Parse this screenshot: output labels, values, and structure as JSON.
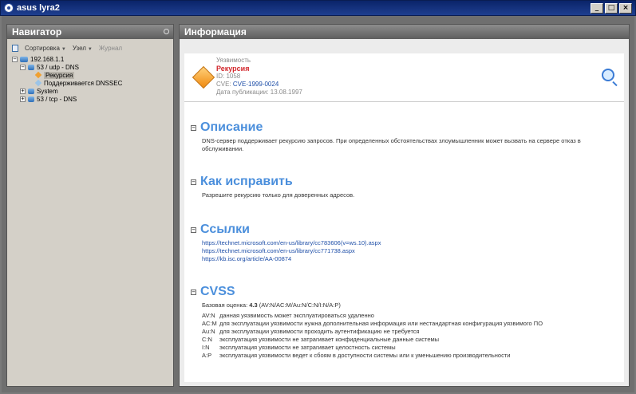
{
  "window": {
    "title": "asus lyra2",
    "buttons": [
      "_",
      "□",
      "×"
    ]
  },
  "navigator": {
    "title": "Навигатор",
    "toolbar": {
      "sort_label": "Сортировка",
      "node_label": "Узел",
      "journal_label": "Журнал"
    },
    "tree": {
      "root": "192.168.1.1",
      "n1": "53 / udp - DNS",
      "n1a": "Рекурсия",
      "n1b": "Поддерживается DNSSEC",
      "n2": "System",
      "n3": "53 / tcp - DNS"
    }
  },
  "info": {
    "title": "Информация",
    "vulnerability": {
      "type_label": "Уязвимость",
      "name": "Рекурсия",
      "id": "ID: 1058",
      "cve_label": "CVE:",
      "cve": "CVE-1999-0024",
      "published": "Дата публикации: 13.08.1997"
    },
    "description": {
      "title": "Описание",
      "text": "DNS-сервер поддерживает рекурсию запросов. При определенных обстоятельствах злоумышленник может вызвать на сервере отказ в обслуживании."
    },
    "fix": {
      "title": "Как исправить",
      "text": "Разрешите рекурсию только для доверенных адресов."
    },
    "links": {
      "title": "Ссылки",
      "items": [
        "https://technet.microsoft.com/en-us/library/cc783606(v=ws.10).aspx",
        "https://technet.microsoft.com/en-us/library/cc771738.aspx",
        "https://kb.isc.org/article/AA-00874"
      ]
    },
    "cvss": {
      "title": "CVSS",
      "base_label": "Базовая оценка:",
      "score": "4.3",
      "vector": "(AV:N/AC:M/Au:N/C:N/I:N/A:P)",
      "items": [
        {
          "k": "AV:N",
          "v": "данная уязвимость может эксплуатироваться удаленно"
        },
        {
          "k": "AC:M",
          "v": "для эксплуатации уязвимости нужна дополнительная информация или нестандартная конфигурация уязвимого ПО"
        },
        {
          "k": "Au:N",
          "v": "для эксплуатации уязвимости проходить аутентификацию не требуется"
        },
        {
          "k": "C:N",
          "v": "эксплуатация уязвимости не затрагивает конфиденциальные данные системы"
        },
        {
          "k": "I:N",
          "v": "эксплуатация уязвимости не затрагивает целостность системы"
        },
        {
          "k": "A:P",
          "v": "эксплуатация уязвимости ведет к сбоям в доступности системы или к уменьшению производительности"
        }
      ]
    }
  }
}
